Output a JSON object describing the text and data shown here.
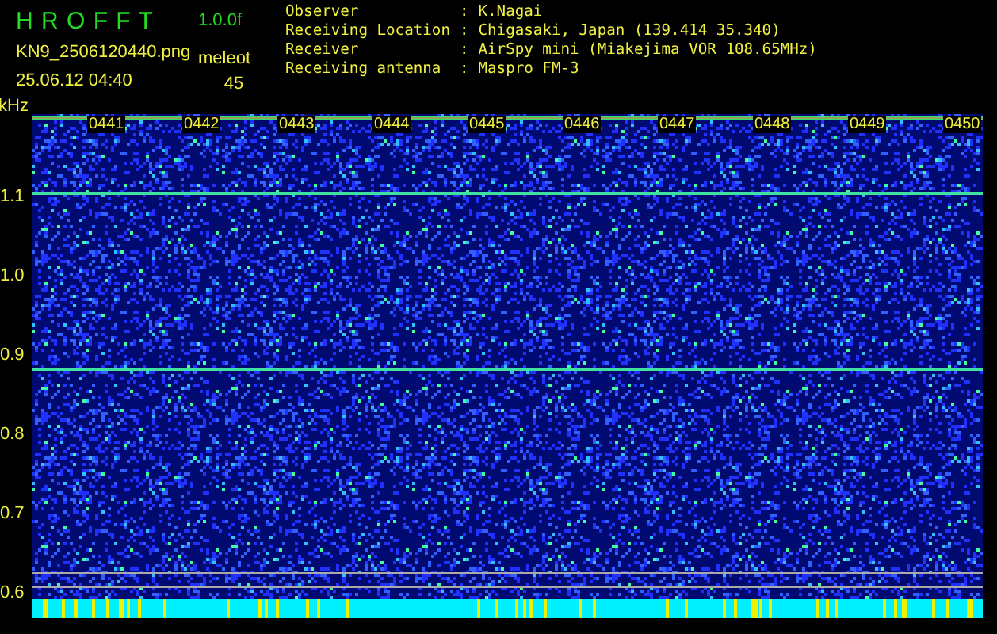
{
  "title": "H R O F F T",
  "version": "1.0.0f",
  "file": "KN9_2506120440.png",
  "datetime": "25.06.12 04:40",
  "event_label": "meleot",
  "event_count": "45",
  "info_separator": ":",
  "info": [
    {
      "label": "Observer",
      "value": "K.Nagai"
    },
    {
      "label": "Receiving Location",
      "value": "Chigasaki, Japan (139.414 35.340)"
    },
    {
      "label": "Receiver",
      "value": "AirSpy mini (Miakejima VOR 108.65MHz)"
    },
    {
      "label": "Receiving antenna",
      "value": "Maspro FM-3"
    }
  ],
  "y_unit": "kHz",
  "y_labels": [
    "1.1",
    "1.0",
    "0.9",
    "0.8",
    "0.7",
    "0.6"
  ],
  "time_labels": [
    "0441",
    "0442",
    "0443",
    "0444",
    "0445",
    "0446",
    "0447",
    "0448",
    "0449",
    "0450"
  ]
}
